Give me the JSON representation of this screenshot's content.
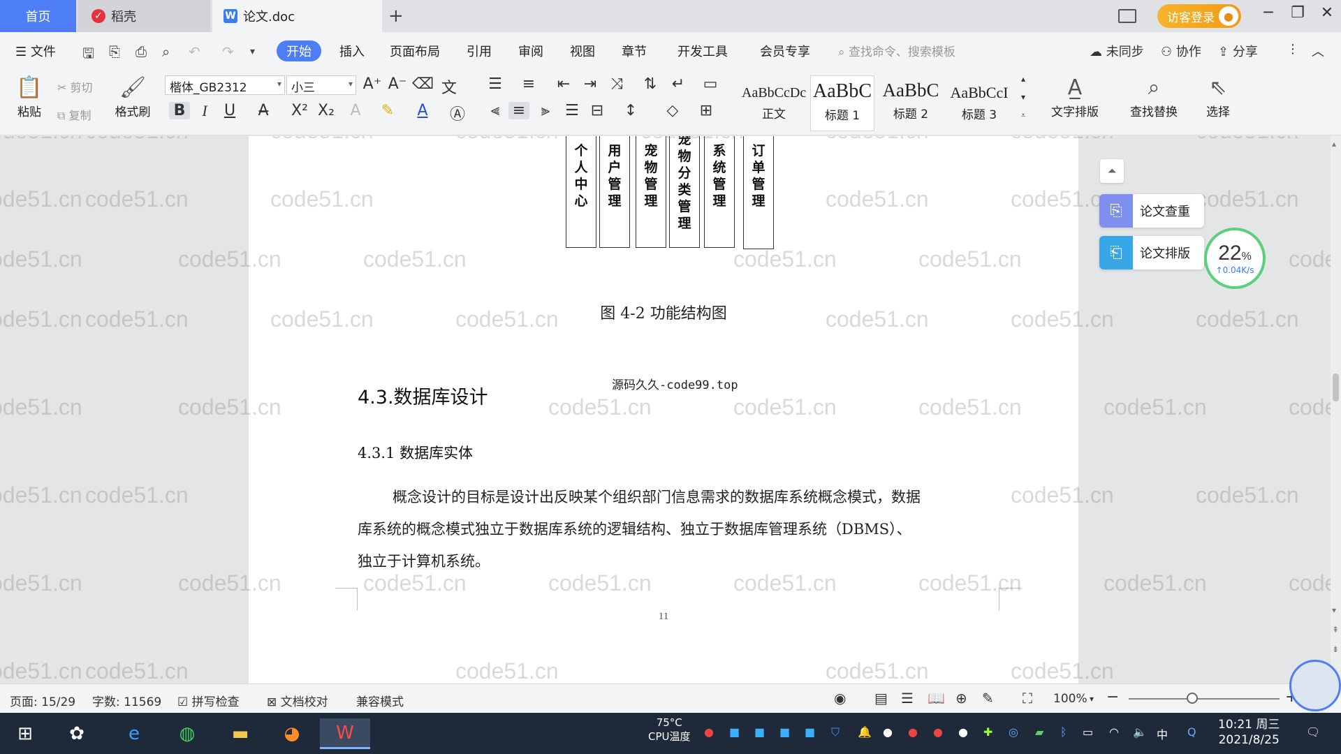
{
  "tabs": {
    "home": "首页",
    "daoke": "稻壳",
    "doc": "论文.doc",
    "add": "+"
  },
  "titlebar": {
    "login": "访客登录",
    "minimize": "─",
    "restore": "❐",
    "close": "✕"
  },
  "menu": {
    "file": "文件",
    "items": [
      "开始",
      "插入",
      "页面布局",
      "引用",
      "审阅",
      "视图",
      "章节",
      "开发工具",
      "会员专享"
    ],
    "search": "查找命令、搜索模板",
    "unsynced": "未同步",
    "collab": "协作",
    "share": "分享"
  },
  "ribbon": {
    "paste": "粘贴",
    "cut": "剪切",
    "copy": "复制",
    "format_painter": "格式刷",
    "font_name": "楷体_GB2312",
    "font_size": "小三",
    "styles": [
      {
        "sample": "AaBbCcDc",
        "label": "正文"
      },
      {
        "sample": "AaBbC",
        "label": "标题 1"
      },
      {
        "sample": "AaBbC",
        "label": "标题 2"
      },
      {
        "sample": "AaBbCcI",
        "label": "标题 3"
      }
    ],
    "text_layout": "文字排版",
    "find_replace": "查找替换",
    "select": "选择"
  },
  "document": {
    "boxes": [
      [
        "个",
        "人",
        "中",
        "心"
      ],
      [
        "用",
        "户",
        "管",
        "理"
      ],
      [
        "宠",
        "物",
        "管",
        "理"
      ],
      [
        "宠",
        "物",
        "分",
        "类",
        "管",
        "理"
      ],
      [
        "系",
        "统",
        "管",
        "理"
      ],
      [
        "订",
        "单",
        "管",
        "理"
      ]
    ],
    "figure_caption": "图 4-2 功能结构图",
    "source_mark": "源码久久-code99.top",
    "heading_2": "4.3.数据库设计",
    "heading_3": "4.3.1 数据库实体",
    "paragraph_lines": [
      "概念设计的目标是设计出反映某个组织部门信息需求的数据库系统概念模式，数据",
      "库系统的概念模式独立于数据库系统的逻辑结构、独立于数据库管理系统（DBMS）、",
      "独立于计算机系统。"
    ],
    "page_number": "11"
  },
  "watermark": "code51.cn",
  "side_panel": {
    "check": "论文查重",
    "layout": "论文排版",
    "percent": "22",
    "percent_unit": "%",
    "speed": "↑0.04K/s"
  },
  "statusbar": {
    "page": "页面: 15/29",
    "words": "字数: 11569",
    "spell": "拼写检查",
    "proof": "文档校对",
    "compat": "兼容模式",
    "zoom": "100%",
    "zoom_level": 0.42
  },
  "taskbar": {
    "cpu_temp": "75°C",
    "cpu_label": "CPU温度",
    "ime": "中",
    "time": "10:21 周三",
    "date": "2021/8/25"
  },
  "colors": {
    "accent": "#4d7ef5",
    "login": "#f29a16",
    "check_icon": "#7e8ff0",
    "layout_icon": "#37a7e8",
    "meter": "#5ad07a"
  }
}
